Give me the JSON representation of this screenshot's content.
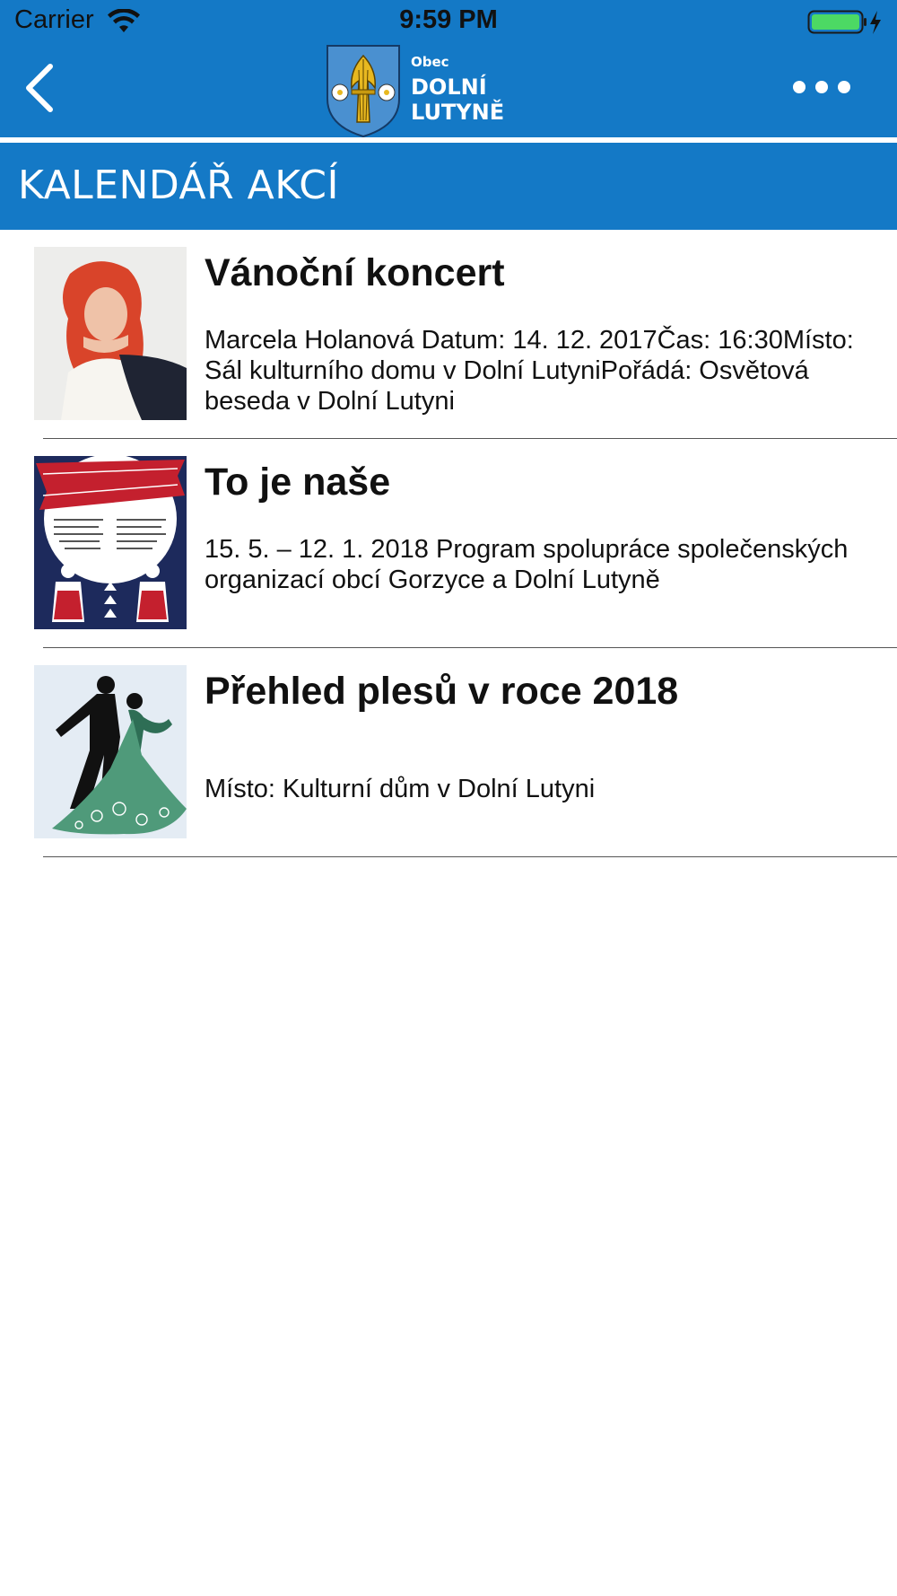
{
  "status_bar": {
    "carrier": "Carrier",
    "time": "9:59 PM"
  },
  "nav": {
    "back_icon": "chevron-left-icon",
    "logo": {
      "small": "Obec",
      "line1": "DOLNÍ",
      "line2": "LUTYNĚ"
    },
    "more_icon": "more-horizontal-icon"
  },
  "section": {
    "title": "KALENDÁŘ AKCÍ"
  },
  "events": [
    {
      "title": "Vánoční koncert",
      "description": "Marcela Holanová  Datum: 14. 12. 2017Čas: 16:30Místo: Sál kulturního domu v Dolní LutyniPořádá: Osvětová beseda v Dolní Lutyni"
    },
    {
      "title": "To je naše",
      "description": "15. 5. – 12. 1. 2018  Program spolupráce společenských organizací obcí Gorzyce a Dolní Lutyně"
    },
    {
      "title": "Přehled plesů v roce 2018",
      "description": "Místo: Kulturní dům v Dolní Lutyni"
    }
  ],
  "colors": {
    "primary_blue": "#1479c6",
    "background": "#ffffff",
    "text": "#111111"
  }
}
